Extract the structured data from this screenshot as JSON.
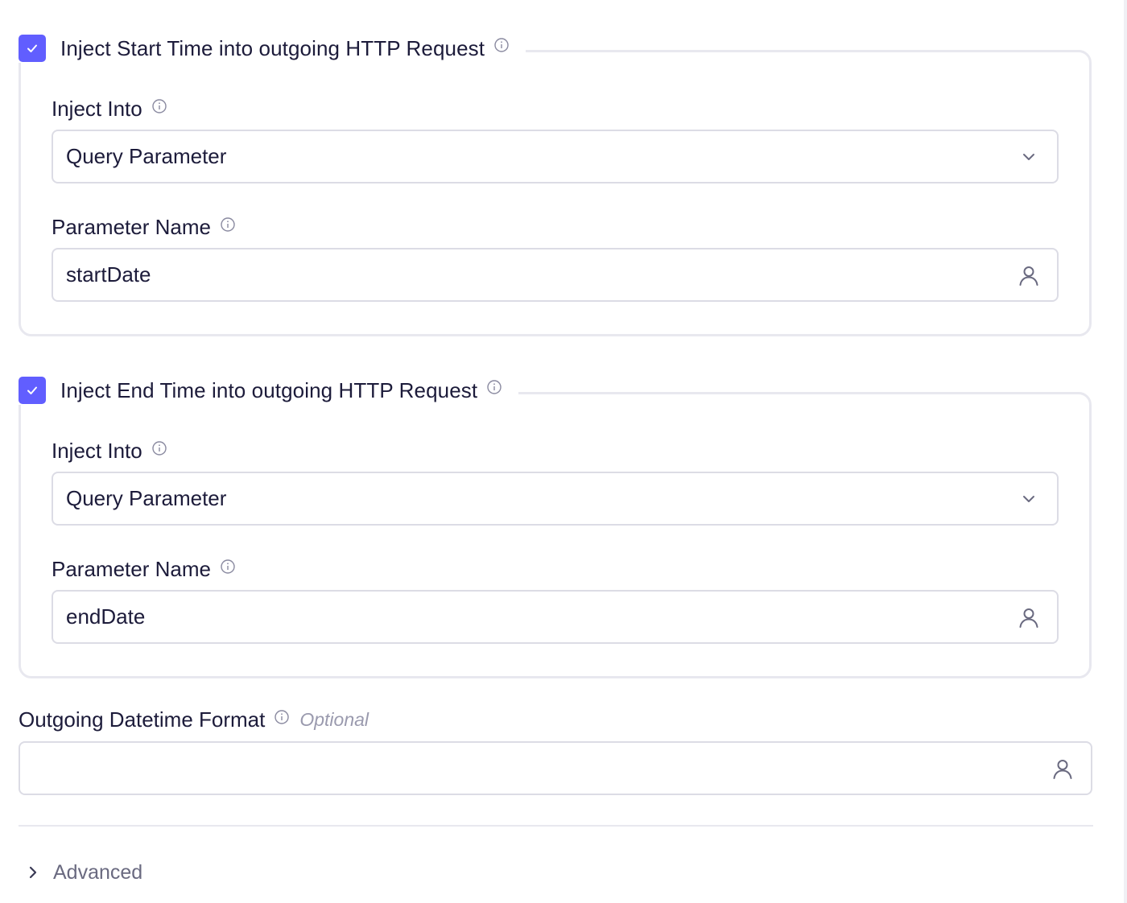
{
  "start_section": {
    "checked": true,
    "title": "Inject Start Time into outgoing HTTP Request",
    "inject_into": {
      "label": "Inject Into",
      "value": "Query Parameter"
    },
    "parameter_name": {
      "label": "Parameter Name",
      "value": "startDate"
    }
  },
  "end_section": {
    "checked": true,
    "title": "Inject End Time into outgoing HTTP Request",
    "inject_into": {
      "label": "Inject Into",
      "value": "Query Parameter"
    },
    "parameter_name": {
      "label": "Parameter Name",
      "value": "endDate"
    }
  },
  "outgoing_format": {
    "label": "Outgoing Datetime Format",
    "optional_text": "Optional",
    "value": ""
  },
  "advanced": {
    "label": "Advanced",
    "expanded": false
  },
  "colors": {
    "accent": "#615eff",
    "text": "#1c1b3a",
    "muted": "#9a9aae",
    "border": "#dcdce5"
  },
  "icons": {
    "checkbox": "check-icon",
    "info": "info-circle-icon",
    "select": "chevron-down-icon",
    "input_user": "user-icon",
    "advanced": "chevron-right-icon"
  }
}
